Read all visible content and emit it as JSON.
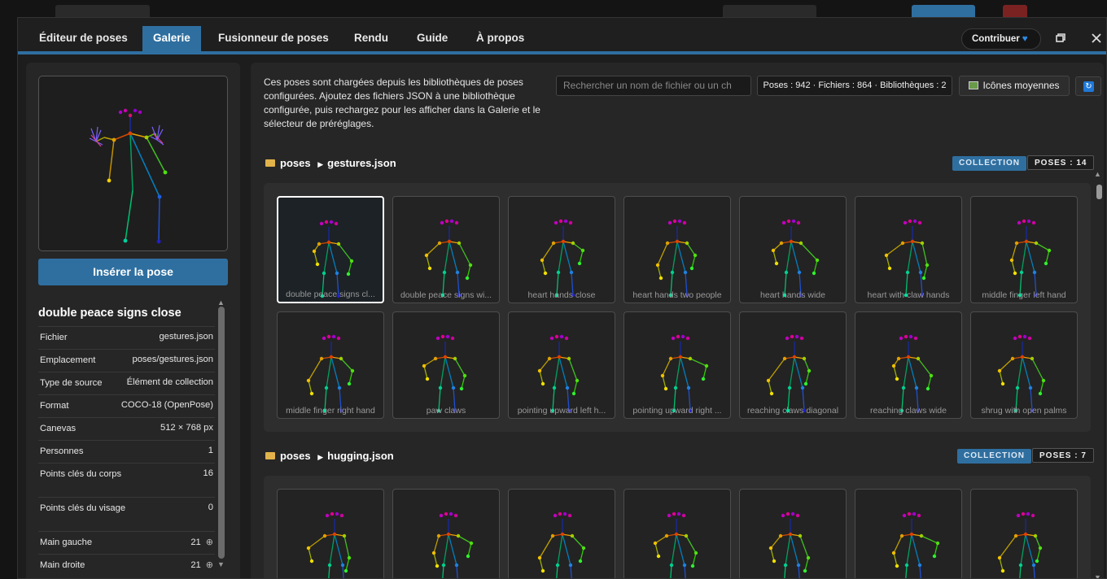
{
  "tabs": [
    "Éditeur de poses",
    "Galerie",
    "Fusionneur de poses",
    "Rendu",
    "Guide",
    "À propos"
  ],
  "active_tab": "Galerie",
  "contribute_label": "Contribuer",
  "left_panel": {
    "insert_label": "Insérer la pose",
    "pose_title": "double peace signs close",
    "rows": [
      {
        "label": "Fichier",
        "value": "gestures.json"
      },
      {
        "label": "Emplacement",
        "value": "poses/gestures.json"
      },
      {
        "label": "Type de source",
        "value": "Élément de collection"
      },
      {
        "label": "Format",
        "value": "COCO-18 (OpenPose)"
      },
      {
        "label": "Canevas",
        "value": "512 × 768 px"
      },
      {
        "label": "Personnes",
        "value": "1"
      },
      {
        "label": "Points clés du corps",
        "value": "16"
      },
      {
        "label": "Points clés du visage",
        "value": "0"
      },
      {
        "label": "Main gauche",
        "value": "21"
      },
      {
        "label": "Main droite",
        "value": "21"
      }
    ]
  },
  "gallery": {
    "description": "Ces poses sont chargées depuis les bibliothèques de poses configurées. Ajoutez des fichiers JSON à une bibliothèque configurée, puis rechargez pour les afficher dans la Galerie et le sélecteur de préréglages.",
    "search_placeholder": "Rechercher un nom de fichier ou un ch",
    "stats": "Poses : 942 · Fichiers : 864 · Bibliothèques : 2",
    "icon_size_label": "Icônes moyennes",
    "sections": [
      {
        "folder": "poses",
        "file": "gestures.json",
        "badge": "COLLECTION",
        "count": "POSES : 14",
        "items": [
          "double peace signs cl...",
          "double peace signs wi...",
          "heart hands close",
          "heart hands two people",
          "heart hands wide",
          "heart with claw hands",
          "middle finger left hand",
          "middle finger right hand",
          "paw claws",
          "pointing upward left h...",
          "pointing upward right ...",
          "reaching claws diagonal",
          "reaching claws wide",
          "shrug with open palms"
        ]
      },
      {
        "folder": "poses",
        "file": "hugging.json",
        "badge": "COLLECTION",
        "count": "POSES : 7",
        "items": [
          "",
          "",
          "",
          "",
          "",
          "",
          ""
        ]
      }
    ]
  }
}
